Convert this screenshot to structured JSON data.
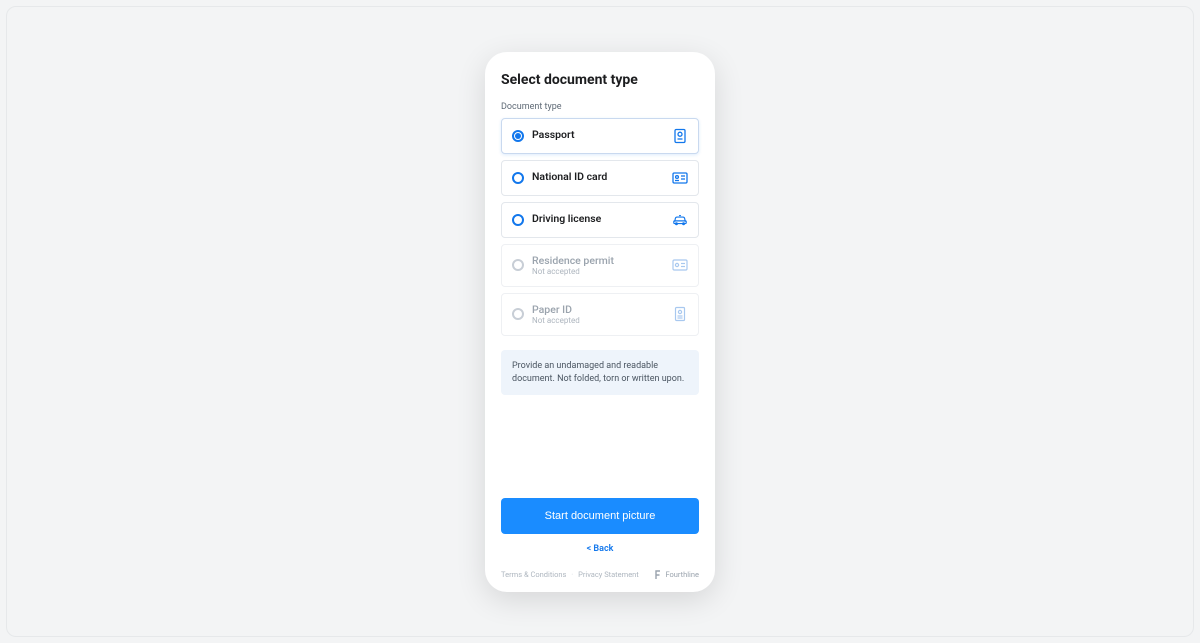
{
  "title": "Select document type",
  "section_label": "Document type",
  "options": [
    {
      "label": "Passport",
      "sub": "",
      "icon": "passport",
      "selected": true,
      "disabled": false
    },
    {
      "label": "National ID card",
      "sub": "",
      "icon": "id-card",
      "selected": false,
      "disabled": false
    },
    {
      "label": "Driving license",
      "sub": "",
      "icon": "car",
      "selected": false,
      "disabled": false
    },
    {
      "label": "Residence permit",
      "sub": "Not accepted",
      "icon": "permit",
      "selected": false,
      "disabled": true
    },
    {
      "label": "Paper ID",
      "sub": "Not accepted",
      "icon": "paper",
      "selected": false,
      "disabled": true
    }
  ],
  "info_text": "Provide an undamaged and readable document. Not folded, torn or written upon.",
  "primary_button": "Start document picture",
  "back_label": "< Back",
  "footer": {
    "terms": "Terms & Conditions",
    "privacy": "Privacy Statement",
    "brand": "Fourthline"
  },
  "colors": {
    "accent": "#1277ec",
    "primary_button": "#1a8cff",
    "info_bg": "#eef4fb"
  }
}
